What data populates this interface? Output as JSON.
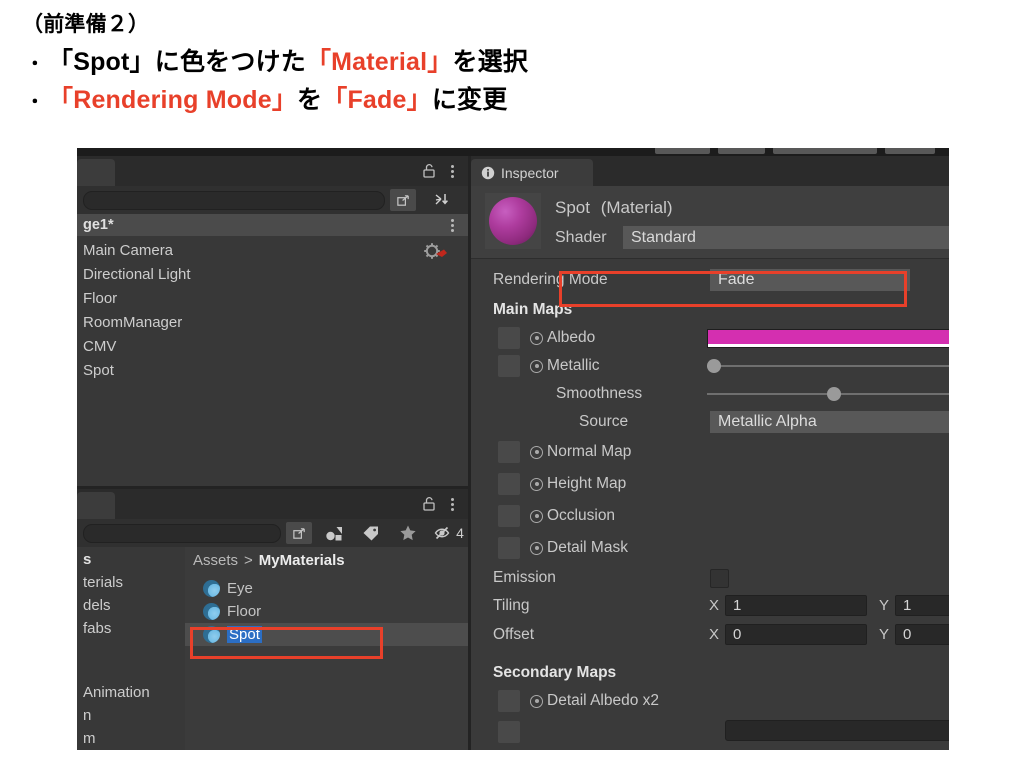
{
  "slide": {
    "title": "（前準備２）",
    "bullets": [
      {
        "marker": "・",
        "parts": [
          {
            "text": "「Spot」に色をつけた",
            "hl": false
          },
          {
            "text": "「Material」",
            "hl": true
          },
          {
            "text": "を選択",
            "hl": false
          }
        ]
      },
      {
        "marker": "・",
        "parts": [
          {
            "text": "「Rendering Mode」",
            "hl": true
          },
          {
            "text": "を",
            "hl": false
          },
          {
            "text": "「Fade」",
            "hl": true
          },
          {
            "text": "に変更",
            "hl": false
          }
        ]
      }
    ],
    "highlight_color": "#e8402a"
  },
  "hierarchy": {
    "tab_label": "",
    "scene_name": "ge1*",
    "items": [
      {
        "label": "Main Camera"
      },
      {
        "label": "Directional Light"
      },
      {
        "label": "Floor"
      },
      {
        "label": "RoomManager"
      },
      {
        "label": "CMV"
      },
      {
        "label": "Spot"
      }
    ]
  },
  "project": {
    "tab_label": "",
    "hidden_count": "4",
    "tree": [
      {
        "label": "s",
        "bold": true
      },
      {
        "label": "terials",
        "bold": false
      },
      {
        "label": "dels",
        "bold": false
      },
      {
        "label": "fabs",
        "bold": false
      },
      {
        "label": "Animation",
        "bold": false
      },
      {
        "label": "n",
        "bold": false
      },
      {
        "label": "m",
        "bold": false
      }
    ],
    "breadcrumb": {
      "root": "Assets",
      "separator": ">",
      "current": "MyMaterials"
    },
    "assets": [
      {
        "name": "Eye",
        "selected": false
      },
      {
        "name": "Floor",
        "selected": false
      },
      {
        "name": "Spot",
        "selected": true
      }
    ]
  },
  "inspector": {
    "tab_label": "Inspector",
    "material_name": "Spot",
    "material_suffix": "(Material)",
    "shader_label": "Shader",
    "shader_value": "Standard",
    "rendering_mode": {
      "label": "Rendering Mode",
      "value": "Fade"
    },
    "main_maps_label": "Main Maps",
    "main_maps": [
      {
        "label": "Albedo",
        "control": "color",
        "value": "#d42fb0"
      },
      {
        "label": "Metallic",
        "control": "slider",
        "value": 0
      },
      {
        "label": "Smoothness",
        "control": "slider",
        "value": 50,
        "indent": true
      },
      {
        "label": "Source",
        "control": "dropdown",
        "value": "Metallic Alpha",
        "indent": true
      },
      {
        "label": "Normal Map",
        "control": "none"
      },
      {
        "label": "Height Map",
        "control": "none"
      },
      {
        "label": "Occlusion",
        "control": "none"
      },
      {
        "label": "Detail Mask",
        "control": "none"
      }
    ],
    "emission": {
      "label": "Emission",
      "checked": false
    },
    "tiling": {
      "label": "Tiling",
      "x_label": "X",
      "x": "1",
      "y_label": "Y",
      "y": "1"
    },
    "offset": {
      "label": "Offset",
      "x_label": "X",
      "x": "0",
      "y_label": "Y",
      "y": "0"
    },
    "secondary_maps_label": "Secondary Maps",
    "secondary_maps": [
      {
        "label": "Detail Albedo x2"
      }
    ]
  }
}
